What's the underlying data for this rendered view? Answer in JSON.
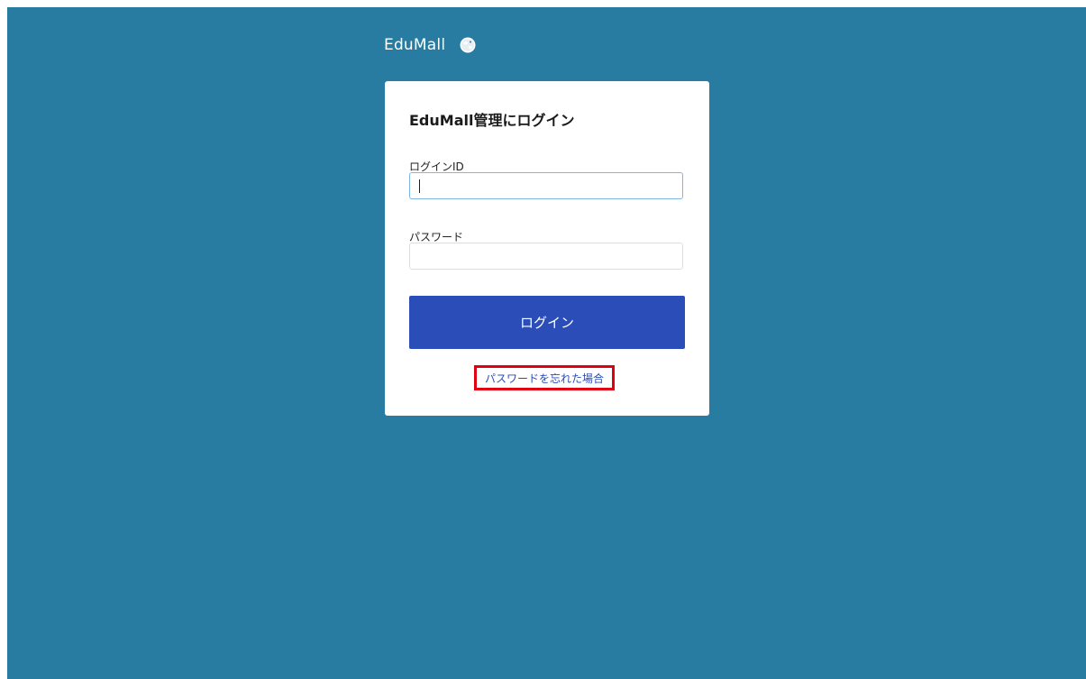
{
  "logo": {
    "text": "EduMall",
    "icon": "globe-icon"
  },
  "login_card": {
    "title": "EduMall管理にログイン",
    "login_id": {
      "label": "ログインID",
      "value": ""
    },
    "password": {
      "label": "パスワード",
      "value": ""
    },
    "submit_label": "ログイン",
    "forgot_password_link": "パスワードを忘れた場合"
  },
  "colors": {
    "background": "#287ca1",
    "button": "#2b4db7",
    "link": "#2b4db7",
    "highlight_box": "#e00012"
  }
}
